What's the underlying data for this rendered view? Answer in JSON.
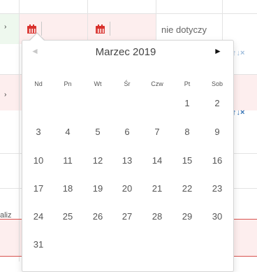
{
  "table": {
    "na_text": "nie dotyczy",
    "cut_text": "aliz",
    "actions": {
      "up": "↑",
      "down": "↓",
      "remove": "×"
    },
    "row_arrow": "›",
    "accent_red": "#d9302c",
    "link_blue": "#2f6fb3"
  },
  "datepicker": {
    "title": "Marzec 2019",
    "prev": "◄",
    "next": "►",
    "days_of_week": [
      "Nd",
      "Pn",
      "Wt",
      "Śr",
      "Czw",
      "Pt",
      "Sob"
    ],
    "weeks": [
      [
        "",
        "",
        "",
        "",
        "",
        "1",
        "2"
      ],
      [
        "3",
        "4",
        "5",
        "6",
        "7",
        "8",
        "9"
      ],
      [
        "10",
        "11",
        "12",
        "13",
        "14",
        "15",
        "16"
      ],
      [
        "17",
        "18",
        "19",
        "20",
        "21",
        "22",
        "23"
      ],
      [
        "24",
        "25",
        "26",
        "27",
        "28",
        "29",
        "30"
      ],
      [
        "31",
        "",
        "",
        "",
        "",
        "",
        ""
      ]
    ]
  }
}
